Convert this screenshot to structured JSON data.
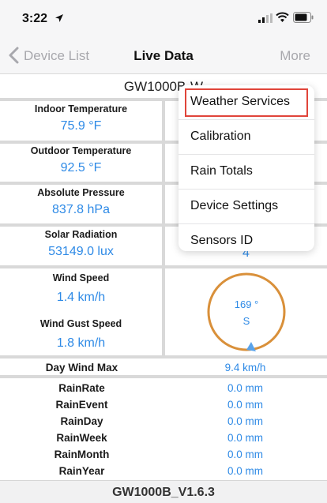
{
  "status_bar": {
    "time": "3:22"
  },
  "nav": {
    "back_label": "Device List",
    "title": "Live Data",
    "more_label": "More"
  },
  "device_title": "GW1000B-W",
  "cells": {
    "indoor_temp": {
      "label": "Indoor Temperature",
      "value": "75.9 °F"
    },
    "outdoor_temp": {
      "label": "Outdoor Temperature",
      "value": "92.5 °F"
    },
    "abs_pressure": {
      "label": "Absolute Pressure",
      "value": "837.8 hPa"
    },
    "solar_radiation": {
      "label": "Solar Radiation",
      "value": "53149.0 lux"
    },
    "uv_value": "4",
    "wind_speed": {
      "label": "Wind Speed",
      "value": "1.4 km/h"
    },
    "wind_gust": {
      "label": "Wind Gust Speed",
      "value": "1.8 km/h"
    }
  },
  "wind_direction": {
    "degrees": "169 °",
    "direction": "S"
  },
  "day_wind_max": {
    "label": "Day Wind Max",
    "value": "9.4 km/h"
  },
  "rain": [
    {
      "label": "RainRate",
      "value": "0.0 mm"
    },
    {
      "label": "RainEvent",
      "value": "0.0 mm"
    },
    {
      "label": "RainDay",
      "value": "0.0 mm"
    },
    {
      "label": "RainWeek",
      "value": "0.0 mm"
    },
    {
      "label": "RainMonth",
      "value": "0.0 mm"
    },
    {
      "label": "RainYear",
      "value": "0.0 mm"
    }
  ],
  "footer": "GW1000B_V1.6.3",
  "menu": {
    "items": [
      {
        "label": "Weather Services",
        "highlighted": true
      },
      {
        "label": "Calibration"
      },
      {
        "label": "Rain Totals"
      },
      {
        "label": "Device Settings"
      },
      {
        "label": "Sensors ID"
      }
    ]
  },
  "colors": {
    "accent": "#2e8ae6",
    "highlight": "#e0443a",
    "compass_ring": "#d9903a"
  }
}
